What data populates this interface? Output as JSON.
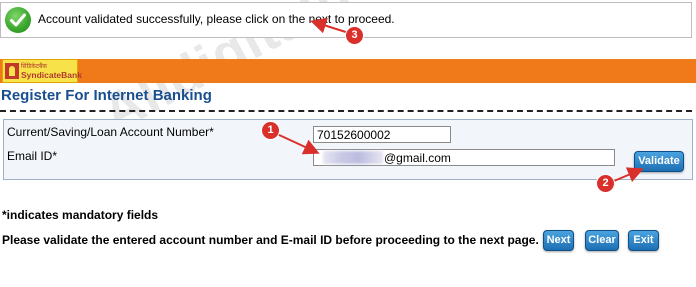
{
  "notification": {
    "message": "Account validated successfully, please click on the next to proceed."
  },
  "header": {
    "bank_logo_tagline": "सिंडिकेटबैंक",
    "bank_logo_name": "SyndicateBank"
  },
  "page": {
    "title": "Register For Internet Banking"
  },
  "form": {
    "account_label": "Current/Saving/Loan Account Number*",
    "account_value": "70152600002",
    "email_label": "Email ID*",
    "email_value_visible": "@gmail.com",
    "validate_label": "Validate"
  },
  "notes": {
    "mandatory": "*indicates mandatory fields",
    "instruction": "Please validate the entered account number and E-mail ID before proceeding to the next page."
  },
  "actions": {
    "next_label": "Next",
    "clear_label": "Clear",
    "exit_label": "Exit"
  },
  "annotations": {
    "marker_1": "1",
    "marker_2": "2",
    "marker_3": "3",
    "marker_color": "#d9302c"
  },
  "watermark": {
    "text": "Alldigitaltricks.com"
  },
  "colors": {
    "accent_orange": "#f07a1a",
    "title_blue": "#1a4f8f",
    "button_blue": "#1d6fb4",
    "success_green": "#3aa52c"
  }
}
